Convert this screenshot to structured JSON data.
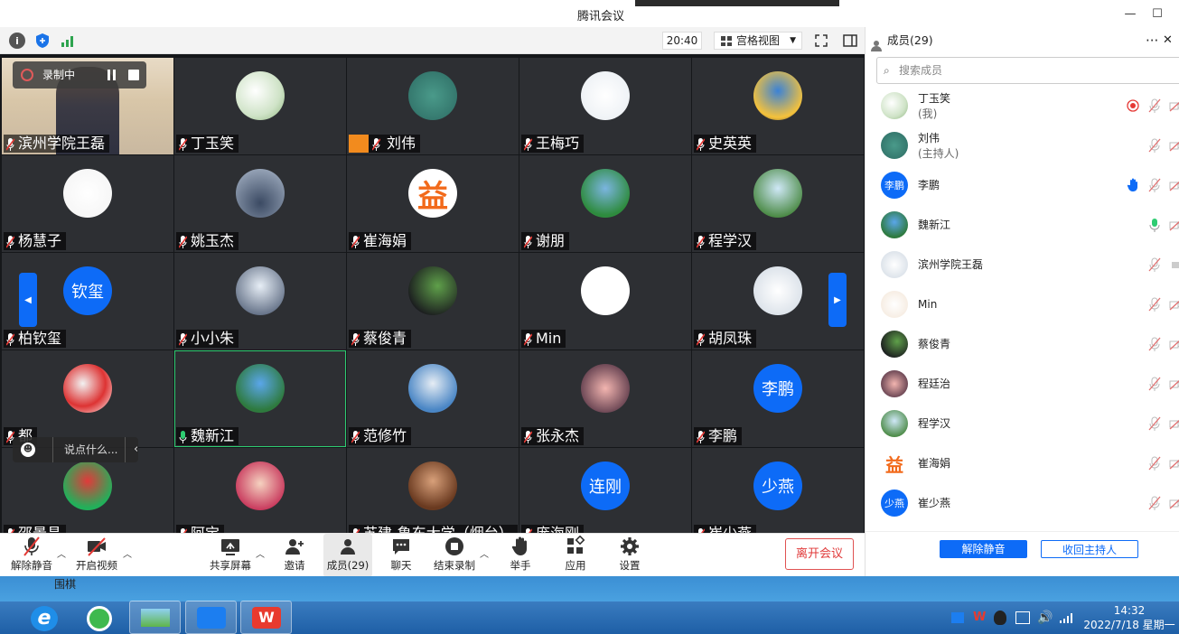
{
  "window": {
    "title": "腾讯会议",
    "minimize": "—",
    "maximize": "☐"
  },
  "toolbar": {
    "time": "20:40",
    "view_mode": "宫格视图"
  },
  "recording": {
    "label": "录制中"
  },
  "grid": {
    "tiles": [
      {
        "name": "滨州学院王磊",
        "avatar": "",
        "mic": "muted"
      },
      {
        "name": "丁玉笑",
        "avatar": "",
        "mic": "muted"
      },
      {
        "name": "刘伟",
        "avatar": "",
        "mic": "muted"
      },
      {
        "name": "王梅巧",
        "avatar": "",
        "mic": "muted"
      },
      {
        "name": "史英英",
        "avatar": "",
        "mic": "muted"
      },
      {
        "name": "杨慧子",
        "avatar": "",
        "mic": "muted"
      },
      {
        "name": "姚玉杰",
        "avatar": "",
        "mic": "muted"
      },
      {
        "name": "崔海娟",
        "avatar": "益",
        "mic": "muted"
      },
      {
        "name": "谢朋",
        "avatar": "",
        "mic": "muted"
      },
      {
        "name": "程学汉",
        "avatar": "",
        "mic": "muted"
      },
      {
        "name": "柏钦玺",
        "avatar": "钦玺",
        "mic": "muted"
      },
      {
        "name": "小小朱",
        "avatar": "",
        "mic": "muted"
      },
      {
        "name": "蔡俊青",
        "avatar": "",
        "mic": "muted"
      },
      {
        "name": "Min",
        "avatar": "",
        "mic": "muted"
      },
      {
        "name": "胡凤珠",
        "avatar": "",
        "mic": "muted"
      },
      {
        "name": "都",
        "avatar": "",
        "mic": "muted"
      },
      {
        "name": "魏新江",
        "avatar": "",
        "mic": "on"
      },
      {
        "name": "范修竹",
        "avatar": "",
        "mic": "muted"
      },
      {
        "name": "张永杰",
        "avatar": "",
        "mic": "muted"
      },
      {
        "name": "李鹏",
        "avatar": "李鹏",
        "mic": "muted"
      },
      {
        "name": "邵景昌",
        "avatar": "",
        "mic": "muted"
      },
      {
        "name": "阿宝",
        "avatar": "",
        "mic": "muted"
      },
      {
        "name": "苏建-鲁东大学（烟台）",
        "avatar": "",
        "mic": "muted"
      },
      {
        "name": "庞海刚",
        "avatar": "连刚",
        "mic": "muted"
      },
      {
        "name": "崔少燕",
        "avatar": "少燕",
        "mic": "muted"
      }
    ]
  },
  "chat_input": {
    "placeholder": "说点什么..."
  },
  "controls": {
    "unmute": "解除静音",
    "video": "开启视频",
    "share": "共享屏幕",
    "invite": "邀请",
    "members": "成员(29)",
    "chat": "聊天",
    "end_record": "结束录制",
    "raise_hand": "举手",
    "apps": "应用",
    "settings": "设置",
    "leave": "离开会议"
  },
  "members_panel": {
    "title": "成员(29)",
    "search_placeholder": "搜索成员",
    "members": [
      {
        "name": "丁玉笑",
        "sub": "(我)",
        "avatar": ""
      },
      {
        "name": "刘伟",
        "sub": "(主持人)",
        "avatar": ""
      },
      {
        "name": "李鹏",
        "sub": "",
        "avatar": "李鹏"
      },
      {
        "name": "魏新江",
        "sub": "",
        "avatar": ""
      },
      {
        "name": "滨州学院王磊",
        "sub": "",
        "avatar": ""
      },
      {
        "name": "Min",
        "sub": "",
        "avatar": ""
      },
      {
        "name": "蔡俊青",
        "sub": "",
        "avatar": ""
      },
      {
        "name": "程廷治",
        "sub": "",
        "avatar": ""
      },
      {
        "name": "程学汉",
        "sub": "",
        "avatar": ""
      },
      {
        "name": "崔海娟",
        "sub": "",
        "avatar": "益"
      },
      {
        "name": "崔少燕",
        "sub": "",
        "avatar": "少燕"
      }
    ],
    "unmute_all": "解除静音",
    "reclaim_host": "收回主持人"
  },
  "taskbar": {
    "behind_label": "围棋",
    "time": "14:32",
    "date": "2022/7/18 星期一"
  },
  "colors": {
    "accent": "#0d6bf7",
    "leave": "#e03a3a",
    "grid_bg": "#2d2f33",
    "active_border": "#2ecc71"
  }
}
